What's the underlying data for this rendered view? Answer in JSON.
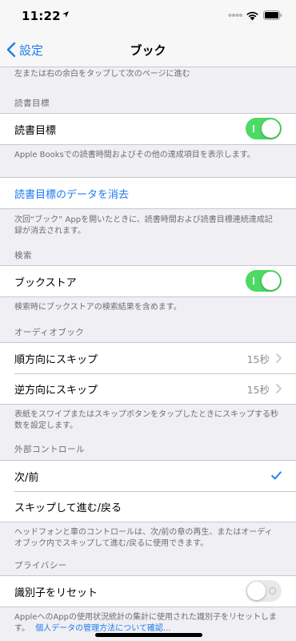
{
  "status_bar": {
    "time": "11:22"
  },
  "nav": {
    "back_label": "設定",
    "title": "ブック"
  },
  "top_note": "左または右の余白をタップして次のページに進む",
  "reading_goals": {
    "header": "読書目標",
    "toggle_label": "読書目標",
    "toggle_on": true,
    "footer": "Apple Booksでの読書時間およびその他の達成項目を表示します。"
  },
  "clear_data": {
    "link_label": "読書目標のデータを消去",
    "footer_line1": "次回“ブック” Appを開いたときに、読書時間および読書目標連続達成記",
    "footer_line2": "録が消去されます。"
  },
  "search": {
    "header": "検索",
    "toggle_label": "ブックストア",
    "toggle_on": true,
    "footer": "検索時にブックストアの検索結果を含めます。"
  },
  "audiobook": {
    "header": "オーディオブック",
    "items": [
      {
        "label": "順方向にスキップ",
        "value": "15秒"
      },
      {
        "label": "逆方向にスキップ",
        "value": "15秒"
      }
    ],
    "footer_line1": "表紙をスワイプまたはスキップボタンをタップしたときにスキップする秒",
    "footer_line2": "数を設定します。"
  },
  "external_controls": {
    "header": "外部コントロール",
    "items": [
      {
        "label": "次/前",
        "checked": true
      },
      {
        "label": "スキップして進む/戻る",
        "checked": false
      }
    ],
    "footer_line1": "ヘッドフォンと車のコントロールは、次/前の章の再生、またはオーディ",
    "footer_line2": "オブック内でスキップして進む/戻るに使用できます。"
  },
  "privacy": {
    "header": "プライバシー",
    "toggle_label": "識別子をリセット",
    "toggle_on": false,
    "footer_line1": "AppleへのAppの使用状況統計の集計に使用された識別子をリセットしま",
    "footer_line2_plain": "す。",
    "footer_link": "個人データの管理方法について確認..."
  },
  "colors": {
    "accent": "#1f7cf0",
    "toggle_on": "#4cd964",
    "background": "#efeff4"
  },
  "icons": [
    "location-arrow-icon",
    "cellular-signal-icon",
    "wifi-icon",
    "battery-icon",
    "chevron-left-icon",
    "chevron-right-icon",
    "checkmark-icon"
  ]
}
